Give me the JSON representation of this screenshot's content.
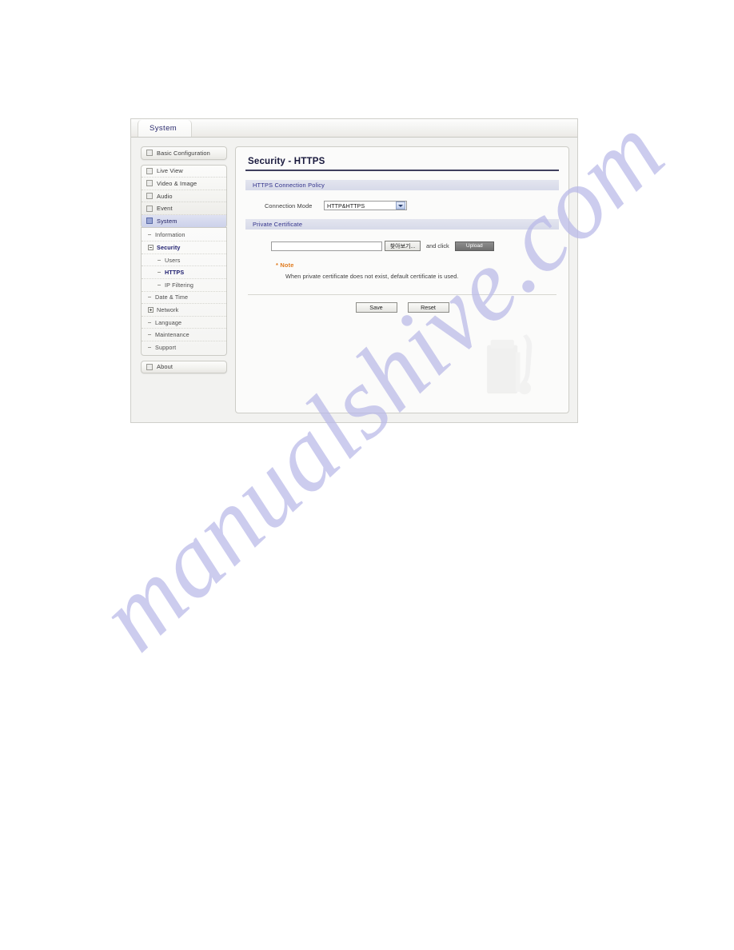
{
  "window": {
    "tab_label": "System"
  },
  "sidebar": {
    "top_group": [
      {
        "label": "Basic Configuration",
        "icon": "expand-box-icon",
        "state": "collapsed"
      }
    ],
    "main_group": [
      {
        "label": "Live View",
        "icon": "expand-box-icon",
        "state": "collapsed"
      },
      {
        "label": "Video & Image",
        "icon": "expand-box-icon",
        "state": "collapsed"
      },
      {
        "label": "Audio",
        "icon": "expand-box-icon",
        "state": "collapsed"
      },
      {
        "label": "Event",
        "icon": "expand-box-icon",
        "state": "collapsed"
      },
      {
        "label": "System",
        "icon": "expand-box-icon",
        "state": "expanded"
      }
    ],
    "system_children": [
      {
        "label": "Information",
        "level": 1,
        "icon": "bullet-dash-icon",
        "active": false
      },
      {
        "label": "Security",
        "level": 1,
        "icon": "collapse-minus-icon",
        "active": true
      },
      {
        "label": "Users",
        "level": 2,
        "icon": "bullet-dash-icon",
        "active": false
      },
      {
        "label": "HTTPS",
        "level": 2,
        "icon": "bullet-dash-icon",
        "active": true
      },
      {
        "label": "IP Filtering",
        "level": 2,
        "icon": "bullet-dash-icon",
        "active": false
      },
      {
        "label": "Date & Time",
        "level": 1,
        "icon": "bullet-dash-icon",
        "active": false
      },
      {
        "label": "Network",
        "level": 1,
        "icon": "expand-plus-icon",
        "active": false
      },
      {
        "label": "Language",
        "level": 1,
        "icon": "bullet-dash-icon",
        "active": false
      },
      {
        "label": "Maintenance",
        "level": 1,
        "icon": "bullet-dash-icon",
        "active": false
      },
      {
        "label": "Support",
        "level": 1,
        "icon": "bullet-dash-icon",
        "active": false
      }
    ],
    "bottom_group": [
      {
        "label": "About",
        "icon": "expand-box-icon",
        "state": "collapsed"
      }
    ]
  },
  "main": {
    "page_title": "Security - HTTPS",
    "sections": {
      "connection_policy": {
        "header": "HTTPS Connection Policy",
        "connection_mode_label": "Connection Mode",
        "connection_mode_value": "HTTP&HTTPS"
      },
      "private_certificate": {
        "header": "Private Certificate",
        "file_path_value": "",
        "file_path_placeholder": "",
        "browse_button": "찾아보기...",
        "and_click_text": "and click",
        "upload_button": "Upload",
        "note_title": "Note",
        "note_star": "*",
        "note_body": "When private certificate does not exist, default certificate is used."
      }
    },
    "actions": {
      "save": "Save",
      "reset": "Reset"
    }
  },
  "watermark": {
    "text": "manualshive.com"
  },
  "colors": {
    "accent_blue": "#30308a",
    "note_orange": "#e07a1d",
    "active_nav": "#1b1b6d",
    "section_bar": "#d7dae9",
    "watermark": "#b9b9e8"
  }
}
